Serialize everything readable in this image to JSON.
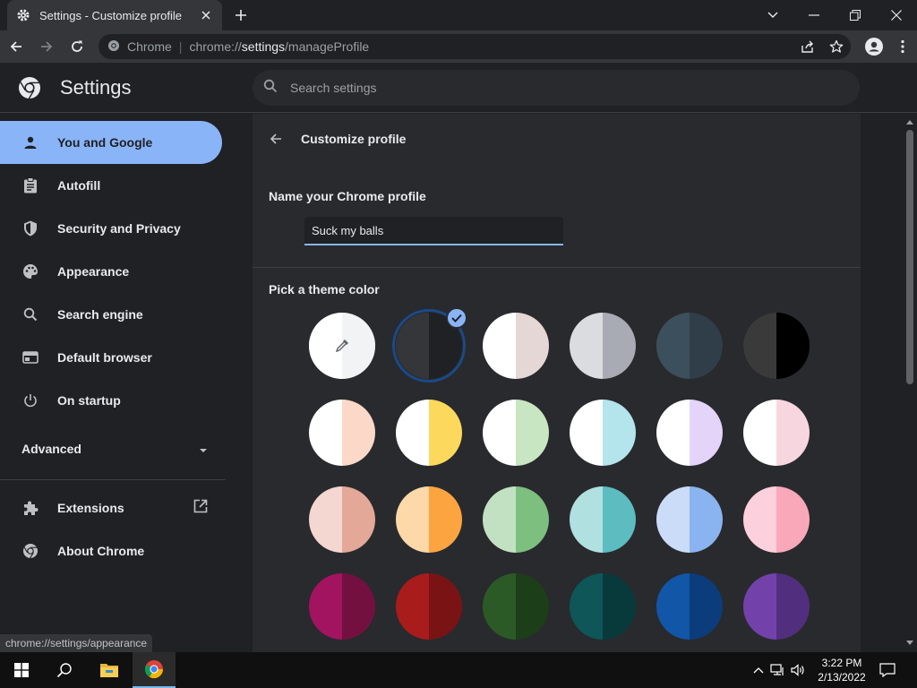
{
  "browser": {
    "tab_title": "Settings - Customize profile",
    "omnibox_site": "Chrome",
    "url_prefix": "chrome://",
    "url_host": "settings",
    "url_path": "/manageProfile"
  },
  "header": {
    "title": "Settings",
    "search_placeholder": "Search settings"
  },
  "sidebar": {
    "items": [
      {
        "label": "You and Google",
        "icon": "person-icon",
        "active": true
      },
      {
        "label": "Autofill",
        "icon": "clipboard-icon"
      },
      {
        "label": "Security and Privacy",
        "icon": "shield-icon"
      },
      {
        "label": "Appearance",
        "icon": "palette-icon"
      },
      {
        "label": "Search engine",
        "icon": "search-icon"
      },
      {
        "label": "Default browser",
        "icon": "browser-window-icon"
      },
      {
        "label": "On startup",
        "icon": "power-icon"
      }
    ],
    "advanced_label": "Advanced",
    "extensions_label": "Extensions",
    "about_label": "About Chrome"
  },
  "profile": {
    "page_title": "Customize profile",
    "name_section": "Name your Chrome profile",
    "name_value": "Suck my balls",
    "theme_section": "Pick a theme color",
    "selected_swatch_index": 1,
    "swatches": [
      [
        "#ffffff",
        "#f1f3f4"
      ],
      [
        "#35363a",
        "#202124"
      ],
      [
        "#ffffff",
        "#e6d7d7"
      ],
      [
        "#dadce0",
        "#a8abb3"
      ],
      [
        "#3c4f5c",
        "#2f3e48"
      ],
      [
        "#3a3a3a",
        "#000000"
      ],
      [
        "#ffffff",
        "#fcd8c8"
      ],
      [
        "#ffffff",
        "#fcd95c"
      ],
      [
        "#ffffff",
        "#c7e6c1"
      ],
      [
        "#ffffff",
        "#b4e4ec"
      ],
      [
        "#ffffff",
        "#e4d4fa"
      ],
      [
        "#ffffff",
        "#f8d6e0"
      ],
      [
        "#f3d7d0",
        "#e3a898"
      ],
      [
        "#fdd8a8",
        "#fba440"
      ],
      [
        "#c2e1c2",
        "#7cbf7e"
      ],
      [
        "#b0e0e0",
        "#5cbcc0"
      ],
      [
        "#cbdcf8",
        "#8ab4f0"
      ],
      [
        "#fcd0dc",
        "#f8a8b8"
      ],
      [
        "#a31460",
        "#74103f"
      ],
      [
        "#a81c1c",
        "#7a1414"
      ],
      [
        "#2c5a26",
        "#1c3e18"
      ],
      [
        "#0e5658",
        "#083a3c"
      ],
      [
        "#1256a8",
        "#0b3c7c"
      ],
      [
        "#7242aa",
        "#512e7e"
      ]
    ]
  },
  "status_bubble": "chrome://settings/appearance",
  "taskbar": {
    "time": "3:22 PM",
    "date": "2/13/2022"
  }
}
